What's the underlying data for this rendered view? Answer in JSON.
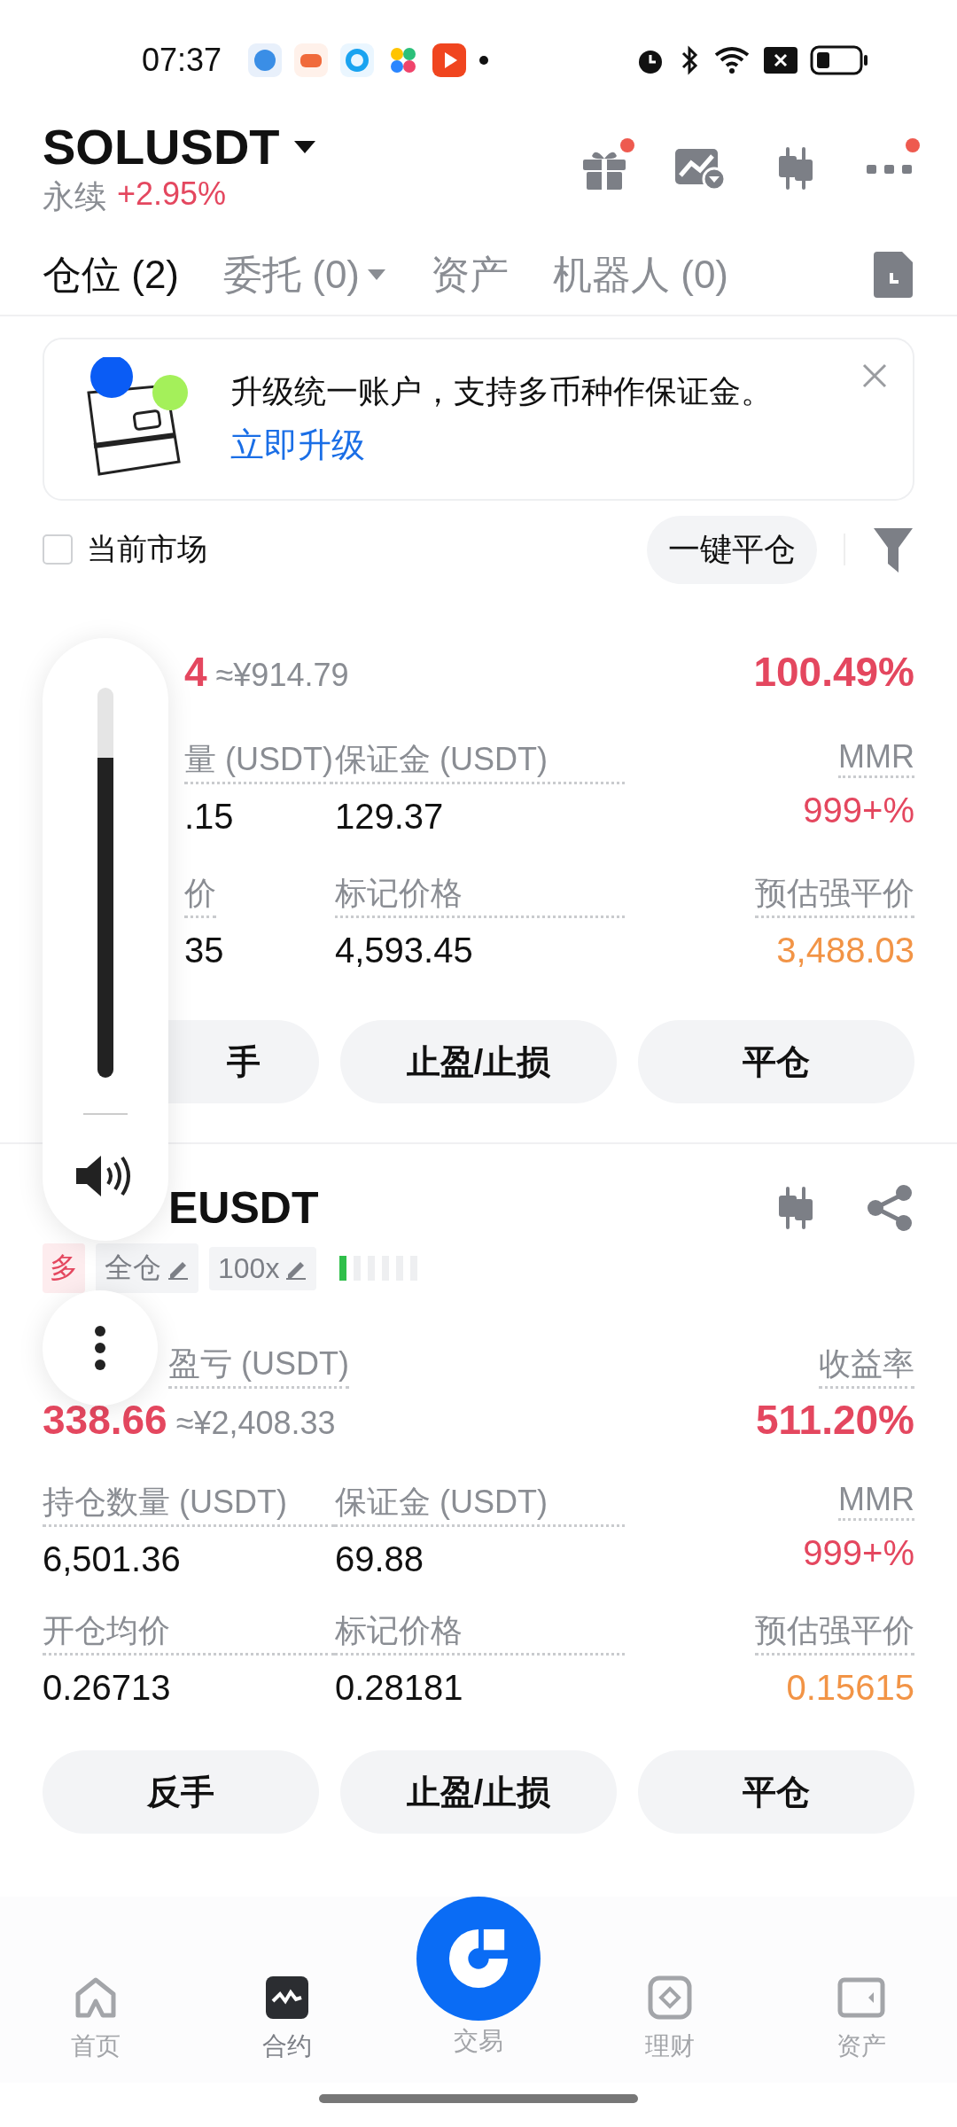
{
  "status_bar": {
    "time": "07:37"
  },
  "header": {
    "symbol": "SOLUSDT",
    "type": "永续",
    "change": "+2.95%",
    "actions": [
      {
        "badge": true
      },
      {
        "badge": false
      },
      {
        "badge": false
      },
      {
        "badge": true
      }
    ]
  },
  "tabs": [
    {
      "label": "仓位 (2)",
      "selected": true,
      "dropdown": false
    },
    {
      "label": "委托 (0)",
      "selected": false,
      "dropdown": true
    },
    {
      "label": "资产",
      "selected": false,
      "dropdown": false
    },
    {
      "label": "机器人 (0)",
      "selected": false,
      "dropdown": false
    }
  ],
  "banner": {
    "text": "升级统一账户，支持多币种作保证金。",
    "link": "立即升级"
  },
  "filter": {
    "label": "当前市场",
    "checked": false,
    "close_all": "一键平仓"
  },
  "positions": [
    {
      "kind": "covered",
      "pnl_value": "4",
      "pnl_cny": "≈¥914.79",
      "roi": "100.49%",
      "fields": [
        {
          "label": "量 (USDT)",
          "value": ".15"
        },
        {
          "label": "保证金 (USDT)",
          "value": "129.37"
        },
        {
          "label": "MMR",
          "value": "999+%"
        },
        {
          "label": "价",
          "value": "35"
        },
        {
          "label": "标记价格",
          "value": "4,593.45"
        },
        {
          "label": "预估强平价",
          "value": "3,488.03"
        }
      ],
      "buttons": [
        "手",
        "止盈/止损",
        "平仓"
      ]
    },
    {
      "kind": "header-covered",
      "symbol": "EUSDT",
      "side": "多",
      "tags": [
        "全仓",
        "100x"
      ],
      "risk": {
        "level": 0.17
      },
      "pnl_label": "盈亏 (USDT)",
      "roi_label": "收益率",
      "pnl_value": "338.66",
      "pnl_cny": "≈¥2,408.33",
      "roi": "511.20%",
      "fields": [
        {
          "label": "持仓数量 (USDT)",
          "value": "6,501.36"
        },
        {
          "label": "保证金 (USDT)",
          "value": "69.88"
        },
        {
          "label": "MMR",
          "value": "999+%"
        },
        {
          "label": "开仓均价",
          "value": "0.26713"
        },
        {
          "label": "标记价格",
          "value": "0.28181"
        },
        {
          "label": "预估强平价",
          "value": "0.15615"
        }
      ],
      "buttons": [
        "反手",
        "止盈/止损",
        "平仓"
      ]
    }
  ],
  "volume": {
    "level": 0.82
  },
  "nav": [
    {
      "label": "首页",
      "kind": "home",
      "selected": false
    },
    {
      "label": "合约",
      "kind": "futures",
      "selected": true
    },
    {
      "label": "交易",
      "kind": "center",
      "selected": false
    },
    {
      "label": "理财",
      "kind": "earn",
      "selected": false
    },
    {
      "label": "资产",
      "kind": "assets",
      "selected": false
    }
  ]
}
